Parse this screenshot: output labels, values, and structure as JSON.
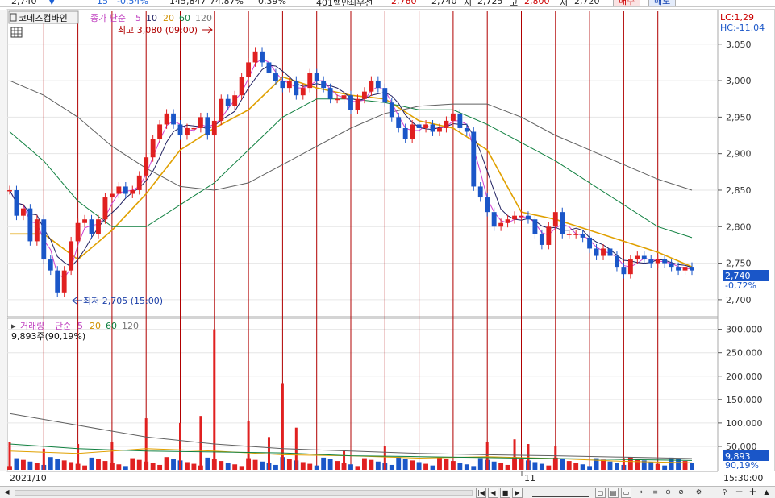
{
  "quote_bar": {
    "price": "2,740",
    "arrow": "▼",
    "change": "15",
    "change_pct": "-0.54%",
    "volume": "145,847",
    "vol_ratio": "74.87%",
    "turnover": "0.39%",
    "amount_label": "401백만",
    "prev_close_label": "최우선",
    "prev_close": "2,760",
    "bid": "2,740",
    "open_label": "시",
    "open": "2,725",
    "high_label": "고",
    "high": "2,800",
    "low_label": "저",
    "low": "2,720",
    "buy_button": "매수",
    "sell_button": "매도"
  },
  "colors": {
    "up": "#e02020",
    "down": "#1a56c8",
    "ma5": "#d040d0",
    "ma10": "#202060",
    "ma20": "#e0a000",
    "ma60": "#108040",
    "ma120": "#606060",
    "session_line": "#b00000",
    "grid": "#e6e6e6",
    "current_tag": "#1a56c8"
  },
  "price_panel": {
    "title": "코데즈컴바인",
    "ma_label": "종가 단순",
    "ma_periods": [
      "5",
      "10",
      "20",
      "60",
      "120"
    ],
    "lc": "LC:1,29",
    "hc": "HC:-11,04",
    "high_marker": "최고 3,080 (09:00)",
    "low_marker": "최저 2,705 (15:00)",
    "current_price": "2,740",
    "current_pct": "-0,72%"
  },
  "volume_panel": {
    "title": "거래량",
    "ma_label": "단순",
    "ma_periods": [
      "5",
      "20",
      "60",
      "120"
    ],
    "current_text": "9,893주(90,19%)",
    "current_value": "9,893",
    "current_pct": "90,19%"
  },
  "time_axis": {
    "start_label": "2021/10",
    "mid_label": "11",
    "end_time": "15:30:00"
  },
  "chart_data": [
    {
      "type": "candlestick",
      "title": "코데즈컴바인",
      "ylim": [
        2680,
        3095
      ],
      "y_ticks": [
        2700,
        2750,
        2800,
        2850,
        2900,
        2950,
        3000,
        3050
      ],
      "y_tick_labels": [
        "2,700",
        "2,750",
        "2,800",
        "2,850",
        "2,900",
        "2,950",
        "3,000",
        "3,050"
      ],
      "x_sessions": 20,
      "series": [
        {
          "name": "가격(종가)",
          "x": [
            0,
            2,
            4,
            6,
            8,
            10,
            12,
            14,
            16,
            18,
            20,
            22,
            24,
            26,
            28,
            30,
            32,
            34,
            36,
            38,
            40,
            42,
            44,
            46,
            48,
            50,
            52,
            54,
            56,
            58,
            60,
            62,
            64,
            66,
            68,
            70,
            72,
            74,
            76,
            78,
            80,
            82,
            84,
            86,
            88,
            90,
            92,
            94,
            96,
            98,
            100,
            102,
            104,
            106,
            108,
            110,
            112,
            114,
            116,
            118,
            120,
            122,
            124,
            126,
            128,
            130,
            132,
            134,
            136,
            138,
            140,
            142,
            144,
            146,
            148,
            150,
            152,
            154,
            156,
            158,
            160,
            162,
            164,
            166,
            168,
            170,
            172,
            174,
            176,
            178,
            180,
            182,
            184,
            186,
            188,
            190,
            192,
            194,
            196,
            198,
            200
          ],
          "values": [
            2850,
            2815,
            2825,
            2780,
            2810,
            2755,
            2740,
            2710,
            2740,
            2780,
            2805,
            2810,
            2790,
            2810,
            2840,
            2845,
            2855,
            2845,
            2850,
            2870,
            2895,
            2920,
            2940,
            2955,
            2940,
            2925,
            2935,
            2935,
            2950,
            2925,
            2945,
            2975,
            2965,
            2980,
            3005,
            3025,
            3040,
            3025,
            3010,
            3000,
            2990,
            3000,
            2980,
            2990,
            3010,
            3000,
            2990,
            2975,
            2975,
            2980,
            2960,
            2975,
            2985,
            3000,
            2990,
            2970,
            2950,
            2935,
            2920,
            2940,
            2935,
            2940,
            2930,
            2935,
            2945,
            2955,
            2935,
            2930,
            2855,
            2840,
            2820,
            2800,
            2805,
            2810,
            2815,
            2815,
            2810,
            2790,
            2775,
            2800,
            2820,
            2790,
            2790,
            2790,
            2785,
            2770,
            2760,
            2770,
            2760,
            2745,
            2735,
            2755,
            2760,
            2755,
            2750,
            2755,
            2750,
            2745,
            2740,
            2745,
            2740
          ]
        },
        {
          "name": "20",
          "x": [
            0,
            10,
            20,
            30,
            40,
            50,
            60,
            70,
            80,
            90,
            100,
            110,
            120,
            130,
            140,
            150,
            160,
            170,
            180,
            190,
            200
          ],
          "values": [
            2790,
            2790,
            2755,
            2795,
            2845,
            2905,
            2935,
            2960,
            3005,
            2990,
            2980,
            2975,
            2945,
            2935,
            2905,
            2820,
            2810,
            2795,
            2780,
            2765,
            2745
          ]
        },
        {
          "name": "60",
          "x": [
            0,
            10,
            20,
            30,
            40,
            50,
            60,
            70,
            80,
            90,
            100,
            110,
            120,
            130,
            140,
            150,
            160,
            170,
            180,
            190,
            200
          ],
          "values": [
            2930,
            2890,
            2835,
            2800,
            2800,
            2830,
            2860,
            2905,
            2950,
            2975,
            2975,
            2970,
            2960,
            2960,
            2940,
            2915,
            2890,
            2860,
            2830,
            2800,
            2785
          ]
        },
        {
          "name": "120",
          "x": [
            0,
            10,
            20,
            30,
            40,
            50,
            60,
            70,
            80,
            90,
            100,
            110,
            120,
            130,
            140,
            150,
            160,
            170,
            180,
            190,
            200
          ],
          "values": [
            3000,
            2980,
            2950,
            2910,
            2880,
            2855,
            2850,
            2860,
            2885,
            2910,
            2935,
            2955,
            2965,
            2968,
            2968,
            2950,
            2925,
            2905,
            2885,
            2865,
            2850
          ]
        }
      ]
    },
    {
      "type": "bar",
      "title": "거래량",
      "ylim": [
        0,
        320000
      ],
      "y_ticks": [
        50000,
        100000,
        150000,
        200000,
        250000,
        300000
      ],
      "y_tick_labels": [
        "50,000",
        "100,000",
        "150,000",
        "200,000",
        "250,000",
        "300,000"
      ],
      "spikes": [
        {
          "x": 0,
          "value": 60000
        },
        {
          "x": 10,
          "value": 45000
        },
        {
          "x": 20,
          "value": 55000
        },
        {
          "x": 30,
          "value": 60000
        },
        {
          "x": 40,
          "value": 110000
        },
        {
          "x": 50,
          "value": 100000
        },
        {
          "x": 56,
          "value": 115000
        },
        {
          "x": 60,
          "value": 300000
        },
        {
          "x": 70,
          "value": 105000
        },
        {
          "x": 76,
          "value": 70000
        },
        {
          "x": 80,
          "value": 185000
        },
        {
          "x": 84,
          "value": 90000
        },
        {
          "x": 98,
          "value": 40000
        },
        {
          "x": 110,
          "value": 50000
        },
        {
          "x": 140,
          "value": 60000
        },
        {
          "x": 148,
          "value": 65000
        },
        {
          "x": 152,
          "value": 55000
        },
        {
          "x": 160,
          "value": 50000
        },
        {
          "x": 180,
          "value": 25000
        }
      ],
      "series": [
        {
          "name": "20",
          "x": [
            0,
            20,
            40,
            60,
            80,
            100,
            120,
            140,
            160,
            180,
            200
          ],
          "values": [
            40000,
            35000,
            45000,
            40000,
            32000,
            30000,
            25000,
            28000,
            24000,
            18000,
            15000
          ]
        },
        {
          "name": "60",
          "x": [
            0,
            20,
            40,
            60,
            80,
            100,
            120,
            140,
            160,
            180,
            200
          ],
          "values": [
            55000,
            45000,
            40000,
            38000,
            36000,
            30000,
            28000,
            26000,
            24000,
            22000,
            20000
          ]
        },
        {
          "name": "120",
          "x": [
            0,
            20,
            40,
            60,
            80,
            100,
            120,
            140,
            160,
            180,
            200
          ],
          "values": [
            120000,
            95000,
            70000,
            55000,
            45000,
            40000,
            35000,
            32000,
            30000,
            27000,
            24000
          ]
        }
      ]
    }
  ]
}
